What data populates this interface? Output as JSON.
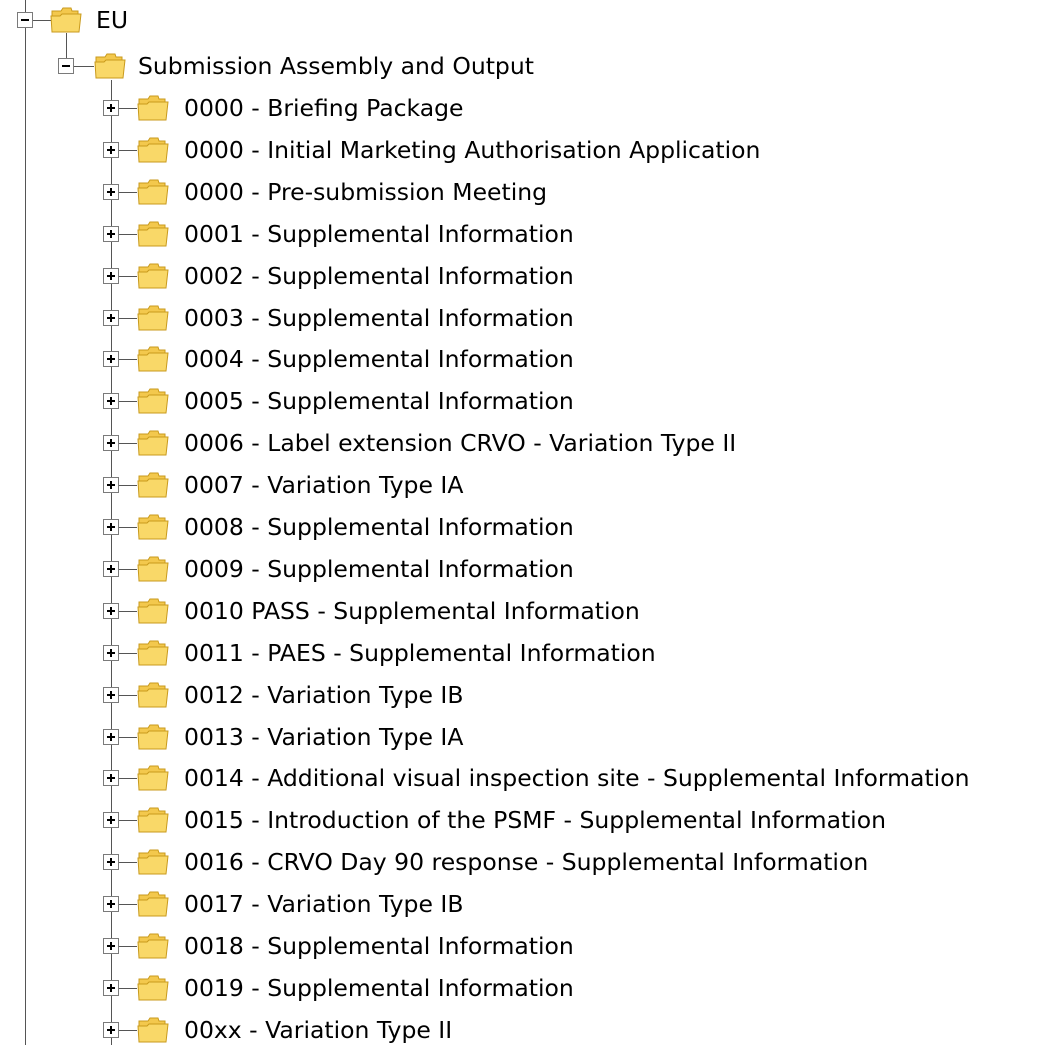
{
  "tree": {
    "root": {
      "label": "EU",
      "expanded": true
    },
    "group": {
      "label": "Submission Assembly and Output",
      "expanded": true
    },
    "items": [
      {
        "label": "0000 - Briefing Package"
      },
      {
        "label": "0000 - Initial Marketing Authorisation Application"
      },
      {
        "label": "0000 - Pre-submission Meeting"
      },
      {
        "label": "0001 - Supplemental Information"
      },
      {
        "label": "0002 - Supplemental Information"
      },
      {
        "label": "0003 - Supplemental Information"
      },
      {
        "label": "0004 - Supplemental Information"
      },
      {
        "label": "0005 - Supplemental Information"
      },
      {
        "label": "0006 - Label extension CRVO - Variation Type II"
      },
      {
        "label": "0007 - Variation Type IA"
      },
      {
        "label": "0008 - Supplemental Information"
      },
      {
        "label": "0009 - Supplemental Information"
      },
      {
        "label": "0010 PASS - Supplemental Information"
      },
      {
        "label": "0011 - PAES - Supplemental Information"
      },
      {
        "label": "0012 - Variation Type IB"
      },
      {
        "label": "0013 - Variation Type IA"
      },
      {
        "label": "0014 - Additional visual inspection site - Supplemental Information"
      },
      {
        "label": "0015 - Introduction of the PSMF - Supplemental Information"
      },
      {
        "label": "0016 - CRVO Day 90 response - Supplemental Information"
      },
      {
        "label": "0017 - Variation Type IB"
      },
      {
        "label": "0018 - Supplemental Information"
      },
      {
        "label": "0019 - Supplemental Information"
      },
      {
        "label": "00xx - Variation Type II"
      }
    ]
  },
  "colors": {
    "folder_fill": "#f9d868",
    "folder_stroke": "#c99a1c",
    "tree_line": "#555555"
  }
}
